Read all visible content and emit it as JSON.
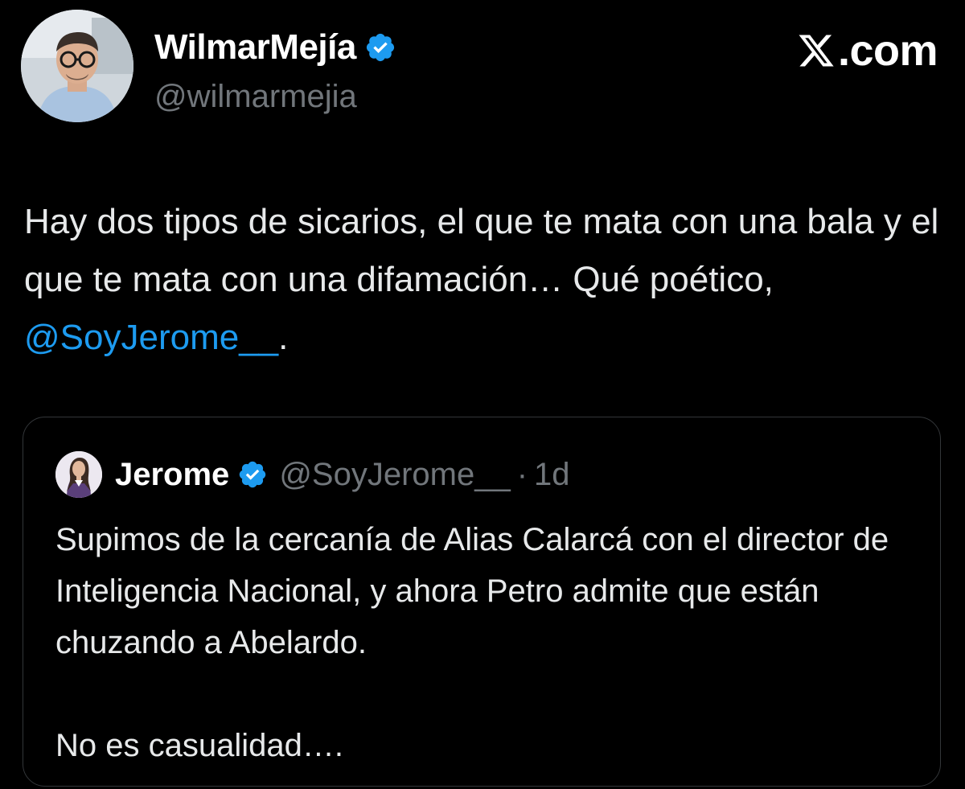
{
  "author": {
    "display_name": "WilmarMejía",
    "handle": "@wilmarmejia",
    "verified": true
  },
  "brand": {
    "label": ".com",
    "icon": "x-logo-icon"
  },
  "tweet": {
    "text_before_mention": "Hay dos tipos de sicarios, el que te mata con una bala y el que te mata con una difamación… Qué poético, ",
    "mention": "@SoyJerome__",
    "text_after_mention": "."
  },
  "quoted_tweet": {
    "display_name": "Jerome",
    "handle": "@SoyJerome__",
    "separator": "·",
    "time": "1d",
    "verified": true,
    "paragraph_1": "Supimos de la cercanía de Alias Calarcá con el director de Inteligencia Nacional, y ahora Petro admite que están chuzando a Abelardo.",
    "paragraph_2": "No es casualidad…."
  },
  "colors": {
    "background": "#000000",
    "text": "#e7e9ea",
    "secondary": "#71767b",
    "link": "#1d9bf0",
    "verified_badge": "#1d9bf0",
    "border": "#333639"
  }
}
